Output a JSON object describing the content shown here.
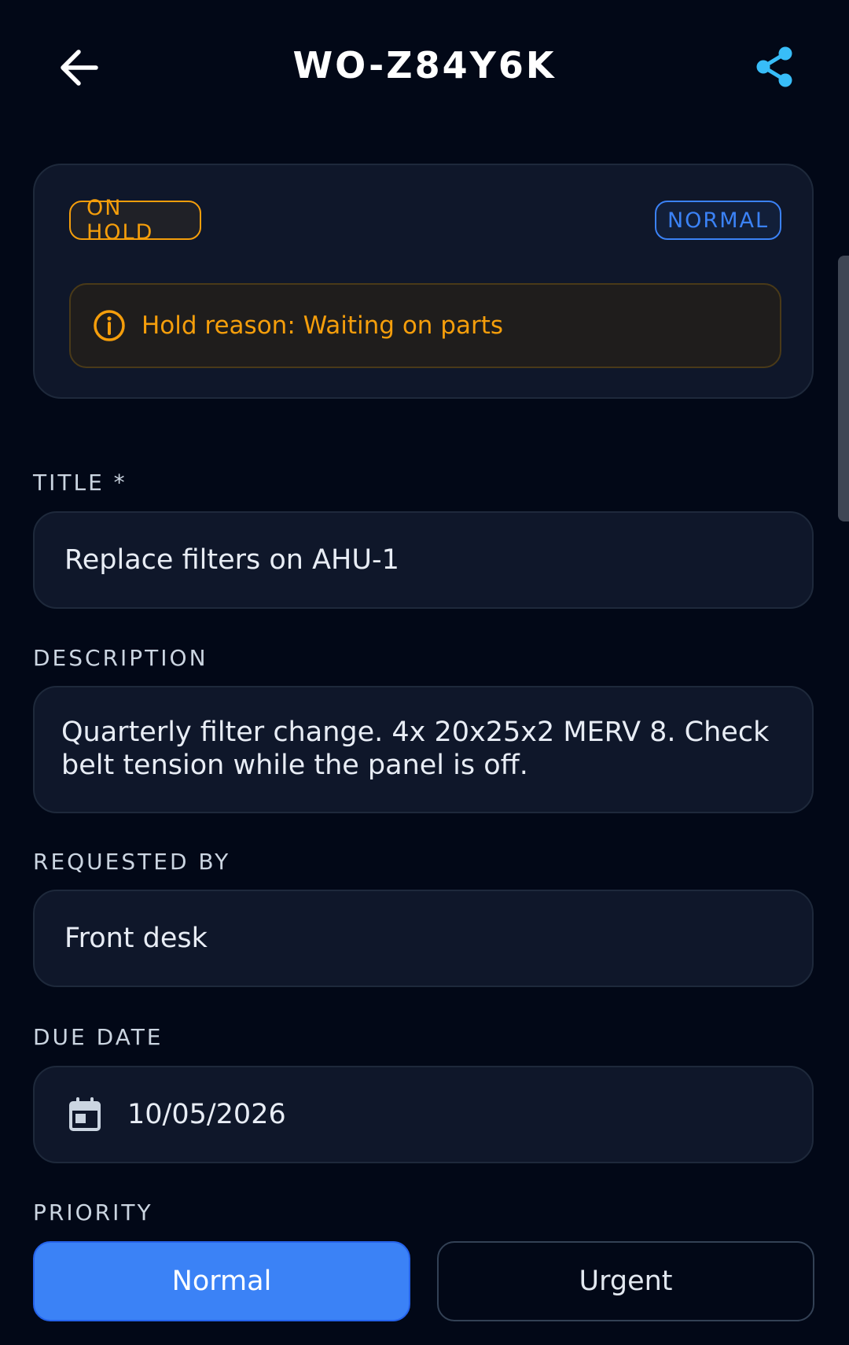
{
  "header": {
    "title": "WO-Z84Y6K"
  },
  "status_card": {
    "status_badge": "ON HOLD",
    "priority_badge": "NORMAL",
    "hold_reason": "Hold reason: Waiting on parts"
  },
  "fields": {
    "title_label": "TITLE *",
    "title_value": "Replace filters on AHU-1",
    "description_label": "DESCRIPTION",
    "description_value": "Quarterly filter change. 4x 20x25x2 MERV 8. Check belt tension while the panel is off.",
    "requested_by_label": "REQUESTED BY",
    "requested_by_value": "Front desk",
    "due_date_label": "DUE DATE",
    "due_date_value": "10/05/2026",
    "priority_label": "PRIORITY"
  },
  "priority_options": {
    "selected": "Normal",
    "normal_label": "Normal",
    "urgent_label": "Urgent"
  },
  "colors": {
    "background": "#020817",
    "card": "#0f172a",
    "accent_blue": "#3b82f6",
    "hold_amber": "#f59e0b"
  },
  "icons": {
    "back": "arrow-left-icon",
    "share": "share-icon",
    "info": "info-icon",
    "calendar": "calendar-icon"
  }
}
